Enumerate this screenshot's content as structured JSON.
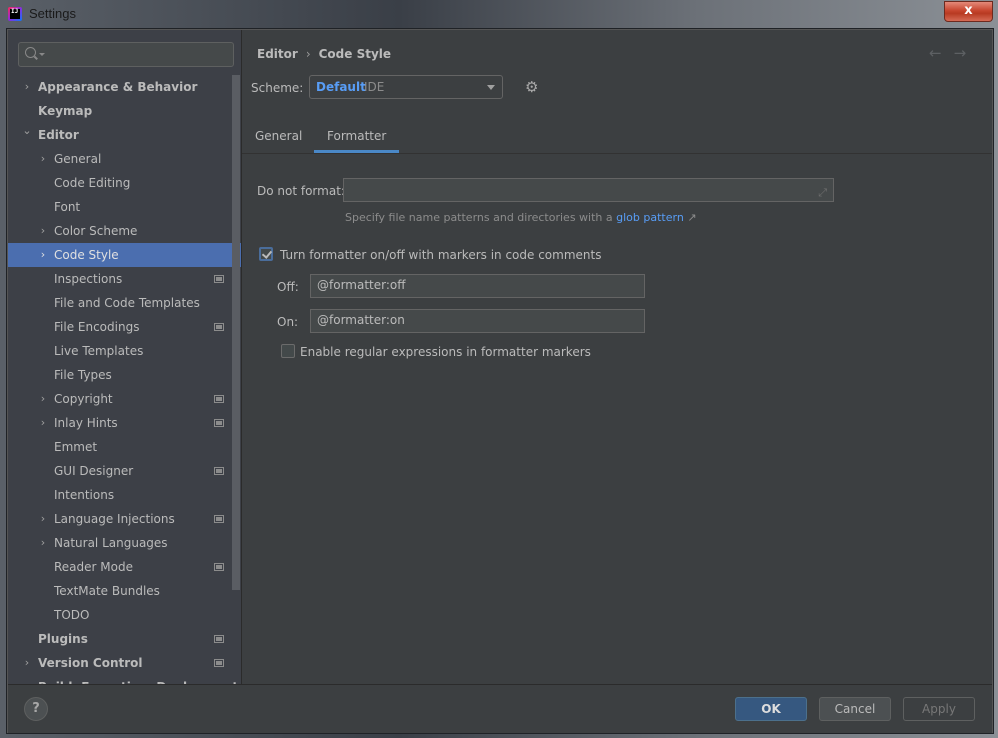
{
  "window": {
    "title": "Settings",
    "close_label": "x"
  },
  "search": {
    "placeholder": ""
  },
  "sidebar": {
    "items": [
      {
        "label": "Appearance & Behavior",
        "level": 0,
        "chevron": "collapsed",
        "badge": false
      },
      {
        "label": "Keymap",
        "level": 0,
        "chevron": "none",
        "badge": false
      },
      {
        "label": "Editor",
        "level": 0,
        "chevron": "expanded",
        "badge": false
      },
      {
        "label": "General",
        "level": 1,
        "chevron": "collapsed",
        "badge": false
      },
      {
        "label": "Code Editing",
        "level": 1,
        "chevron": "none",
        "badge": false
      },
      {
        "label": "Font",
        "level": 1,
        "chevron": "none",
        "badge": false
      },
      {
        "label": "Color Scheme",
        "level": 1,
        "chevron": "collapsed",
        "badge": false
      },
      {
        "label": "Code Style",
        "level": 1,
        "chevron": "collapsed",
        "badge": false,
        "selected": true
      },
      {
        "label": "Inspections",
        "level": 1,
        "chevron": "none",
        "badge": true
      },
      {
        "label": "File and Code Templates",
        "level": 1,
        "chevron": "none",
        "badge": false
      },
      {
        "label": "File Encodings",
        "level": 1,
        "chevron": "none",
        "badge": true
      },
      {
        "label": "Live Templates",
        "level": 1,
        "chevron": "none",
        "badge": false
      },
      {
        "label": "File Types",
        "level": 1,
        "chevron": "none",
        "badge": false
      },
      {
        "label": "Copyright",
        "level": 1,
        "chevron": "collapsed",
        "badge": true
      },
      {
        "label": "Inlay Hints",
        "level": 1,
        "chevron": "collapsed",
        "badge": true
      },
      {
        "label": "Emmet",
        "level": 1,
        "chevron": "none",
        "badge": false
      },
      {
        "label": "GUI Designer",
        "level": 1,
        "chevron": "none",
        "badge": true
      },
      {
        "label": "Intentions",
        "level": 1,
        "chevron": "none",
        "badge": false
      },
      {
        "label": "Language Injections",
        "level": 1,
        "chevron": "collapsed",
        "badge": true
      },
      {
        "label": "Natural Languages",
        "level": 1,
        "chevron": "collapsed",
        "badge": false
      },
      {
        "label": "Reader Mode",
        "level": 1,
        "chevron": "none",
        "badge": true
      },
      {
        "label": "TextMate Bundles",
        "level": 1,
        "chevron": "none",
        "badge": false
      },
      {
        "label": "TODO",
        "level": 1,
        "chevron": "none",
        "badge": false
      },
      {
        "label": "Plugins",
        "level": 0,
        "chevron": "none",
        "badge": true
      },
      {
        "label": "Version Control",
        "level": 0,
        "chevron": "collapsed",
        "badge": true
      },
      {
        "label": "Build, Execution, Deployment",
        "level": 0,
        "chevron": "collapsed",
        "badge": false
      }
    ]
  },
  "breadcrumb": {
    "parent": "Editor",
    "separator": "›",
    "current": "Code Style"
  },
  "nav": {
    "back": "←",
    "forward": "→"
  },
  "scheme": {
    "label": "Scheme:",
    "value": "Default",
    "sub": "IDE"
  },
  "tabs": [
    {
      "label": "General",
      "active": false
    },
    {
      "label": "Formatter",
      "active": true
    }
  ],
  "formatter": {
    "do_not_format_label": "Do not format:",
    "do_not_format_value": "",
    "hint_text": "Specify file name patterns and directories with a",
    "hint_link": "glob pattern",
    "hint_link_arrow": "↗",
    "markers_checkbox_label": "Turn formatter on/off with markers in code comments",
    "markers_checked": true,
    "off_label": "Off:",
    "off_value": "@formatter:off",
    "on_label": "On:",
    "on_value": "@formatter:on",
    "regex_checkbox_label": "Enable regular expressions in formatter markers",
    "regex_checked": false
  },
  "footer": {
    "help": "?",
    "ok": "OK",
    "cancel": "Cancel",
    "apply": "Apply"
  }
}
